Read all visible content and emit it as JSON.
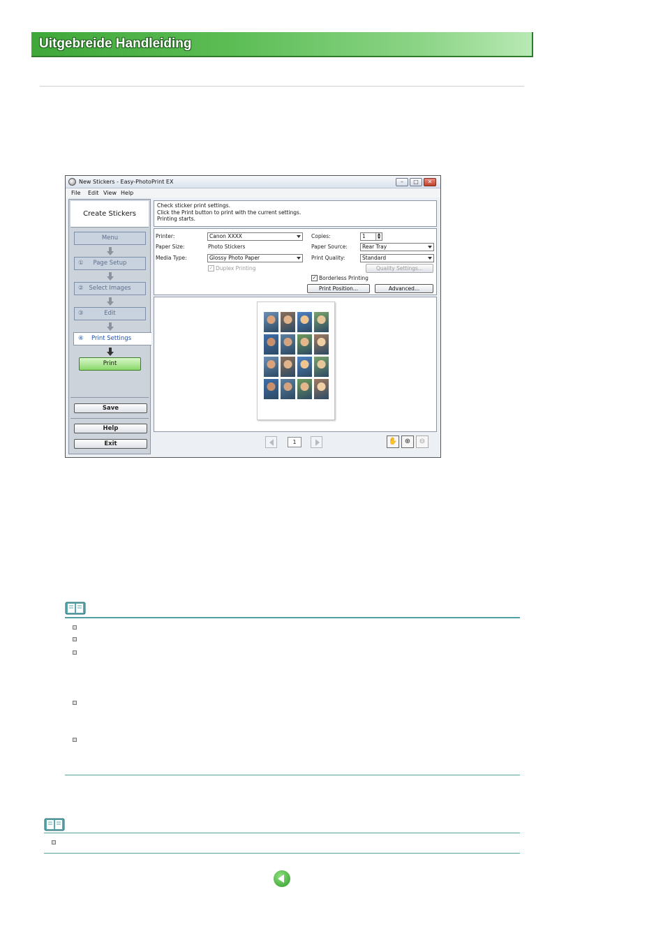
{
  "header": {
    "title": "Uitgebreide Handleiding"
  },
  "window": {
    "title": "New Stickers - Easy-PhotoPrint EX",
    "menu": [
      "File",
      "Edit",
      "View",
      "Help"
    ],
    "controls": {
      "minimize": "–",
      "maximize": "□",
      "close": "✕"
    }
  },
  "sidebar": {
    "heading": "Create Stickers",
    "steps": [
      {
        "num": "",
        "label": "Menu"
      },
      {
        "num": "①",
        "label": "Page Setup"
      },
      {
        "num": "②",
        "label": "Select Images"
      },
      {
        "num": "③",
        "label": "Edit"
      }
    ],
    "active": {
      "num": "④",
      "label": "Print Settings"
    },
    "print_label": "Print",
    "save_label": "Save",
    "help_label": "Help",
    "exit_label": "Exit"
  },
  "instructions": [
    "Check sticker print settings.",
    "Click the Print button to print with the current settings.",
    "Printing starts."
  ],
  "settings": {
    "printer_label": "Printer:",
    "printer_value": "Canon XXXX",
    "paper_size_label": "Paper Size:",
    "paper_size_value": "Photo Stickers",
    "media_type_label": "Media Type:",
    "media_type_value": "Glossy Photo Paper",
    "duplex_label": "Duplex Printing",
    "copies_label": "Copies:",
    "copies_value": "1",
    "paper_source_label": "Paper Source:",
    "paper_source_value": "Rear Tray",
    "print_quality_label": "Print Quality:",
    "print_quality_value": "Standard",
    "quality_settings_label": "Quality Settings...",
    "borderless_label": "Borderless Printing",
    "print_position_label": "Print Position...",
    "advanced_label": "Advanced...",
    "check_mark": "✓"
  },
  "preview": {
    "page_number": "1",
    "tools": [
      "✋",
      "⊕",
      "⊖"
    ]
  }
}
